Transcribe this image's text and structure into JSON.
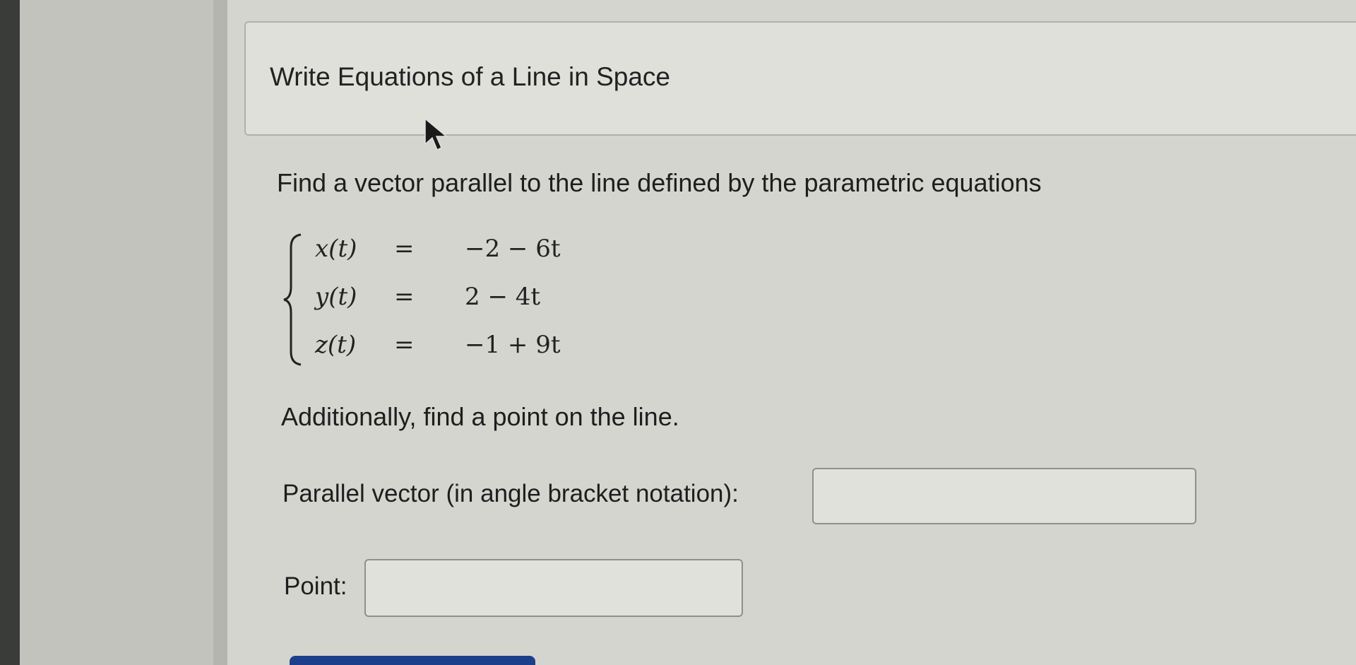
{
  "page": {
    "title": "Write Equations of a Line in Space"
  },
  "problem": {
    "question": "Find a vector parallel to the line defined by the parametric equations",
    "equations": [
      {
        "lhs": "x(t)",
        "sign": "=",
        "rhs": "−2 − 6t"
      },
      {
        "lhs": "y(t)",
        "sign": "=",
        "rhs": "2 − 4t"
      },
      {
        "lhs": "z(t)",
        "sign": "=",
        "rhs": "−1 + 9t"
      }
    ],
    "followup": "Additionally, find a point on the line."
  },
  "answers": {
    "vector_label": "Parallel vector (in angle bracket notation):",
    "vector_value": "",
    "point_label": "Point:",
    "point_value": ""
  },
  "colors": {
    "submit_button": "#1c3f8c",
    "background": "#d4d5cf"
  },
  "icons": {
    "cursor": "mouse-pointer-icon",
    "brace": "left-brace-icon"
  }
}
